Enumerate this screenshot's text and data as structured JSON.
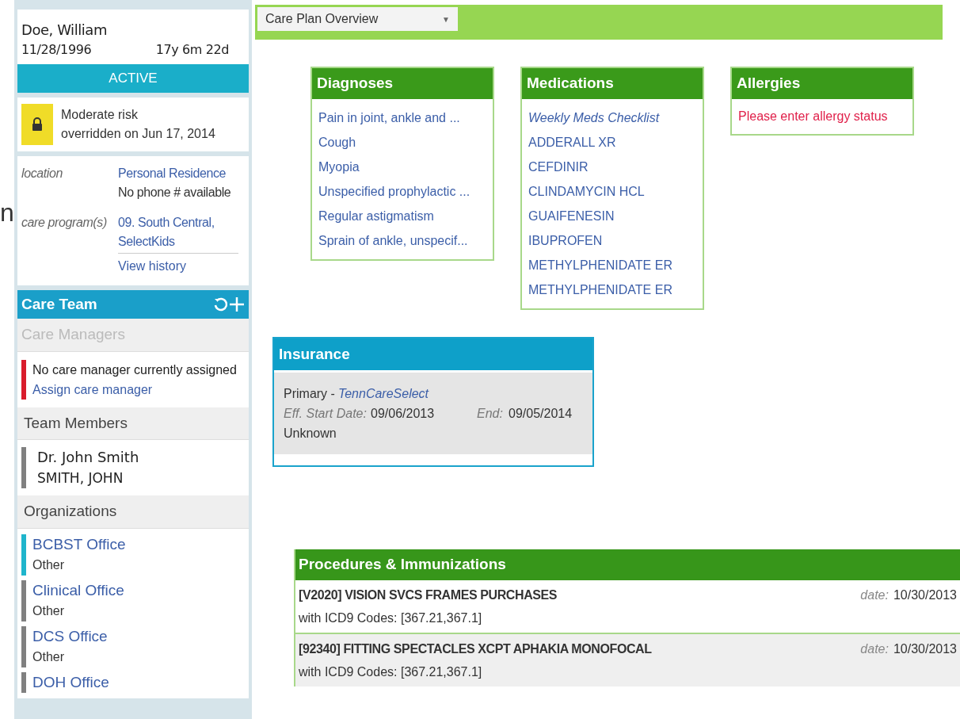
{
  "edge_text": "n",
  "patient": {
    "name": "Doe, William",
    "dob": "11/28/1996",
    "age": "17y 6m 22d",
    "status": "ACTIVE"
  },
  "risk": {
    "level": "Moderate risk",
    "note": "overridden on Jun 17, 2014"
  },
  "details": [
    {
      "label": "location",
      "lines": [
        {
          "text": "Personal Residence",
          "kind": "link"
        },
        {
          "text": "No phone # available",
          "kind": "plain"
        }
      ]
    },
    {
      "label": "care program(s)",
      "lines": [
        {
          "text": "09. South Central, SelectKids",
          "kind": "link"
        }
      ]
    }
  ],
  "view_history": "View history",
  "care_team": {
    "title": "Care Team",
    "care_managers": {
      "heading": "Care Managers",
      "message": "No care manager currently assigned",
      "action": "Assign care manager",
      "color": "#d91c2c"
    },
    "team_members": {
      "heading": "Team Members",
      "items": [
        {
          "name": "Dr. John Smith",
          "sub": "SMITH, JOHN",
          "color": "#808080"
        }
      ]
    },
    "organizations": {
      "heading": "Organizations",
      "items": [
        {
          "name": "BCBST Office",
          "sub": "Other",
          "color": "#1fb5cc"
        },
        {
          "name": "Clinical Office",
          "sub": "Other",
          "color": "#808080"
        },
        {
          "name": "DCS Office",
          "sub": "Other",
          "color": "#808080"
        },
        {
          "name": "DOH Office",
          "color": "#808080"
        }
      ]
    }
  },
  "view_select": {
    "value": "Care Plan Overview",
    "caret": "▼"
  },
  "diagnoses": {
    "title": "Diagnoses",
    "items": [
      "Pain in joint, ankle and ...",
      "Cough",
      "Myopia",
      "Unspecified prophylactic ...",
      "Regular astigmatism",
      "Sprain of ankle, unspecif..."
    ]
  },
  "medications": {
    "title": "Medications",
    "items": [
      {
        "text": "Weekly Meds Checklist",
        "kind": "checklist"
      },
      {
        "text": "ADDERALL XR",
        "kind": "drug"
      },
      {
        "text": "CEFDINIR",
        "kind": "drug"
      },
      {
        "text": "CLINDAMYCIN HCL",
        "kind": "drug"
      },
      {
        "text": "GUAIFENESIN",
        "kind": "drug"
      },
      {
        "text": "IBUPROFEN",
        "kind": "drug"
      },
      {
        "text": "METHYLPHENIDATE ER",
        "kind": "drug"
      },
      {
        "text": "METHYLPHENIDATE ER",
        "kind": "drug"
      }
    ]
  },
  "allergies": {
    "title": "Allergies",
    "message": "Please enter allergy status"
  },
  "insurance": {
    "title": "Insurance",
    "type": "Primary -",
    "plan": "TennCareSelect",
    "start_label": "Eff. Start Date:",
    "start": "09/06/2013",
    "end_label": "End:",
    "end": "09/05/2014",
    "status": "Unknown"
  },
  "procedures": {
    "title": "Procedures & Immunizations",
    "rows": [
      {
        "name": "[V2020] VISION SVCS FRAMES PURCHASES",
        "codes": "with ICD9 Codes: [367.21,367.1]",
        "date_label": "date:",
        "date": "10/30/2013"
      },
      {
        "name": "[92340] FITTING SPECTACLES XCPT APHAKIA MONOFOCAL",
        "codes": "with ICD9 Codes: [367.21,367.1]",
        "date_label": "date:",
        "date": "10/30/2013"
      }
    ]
  }
}
